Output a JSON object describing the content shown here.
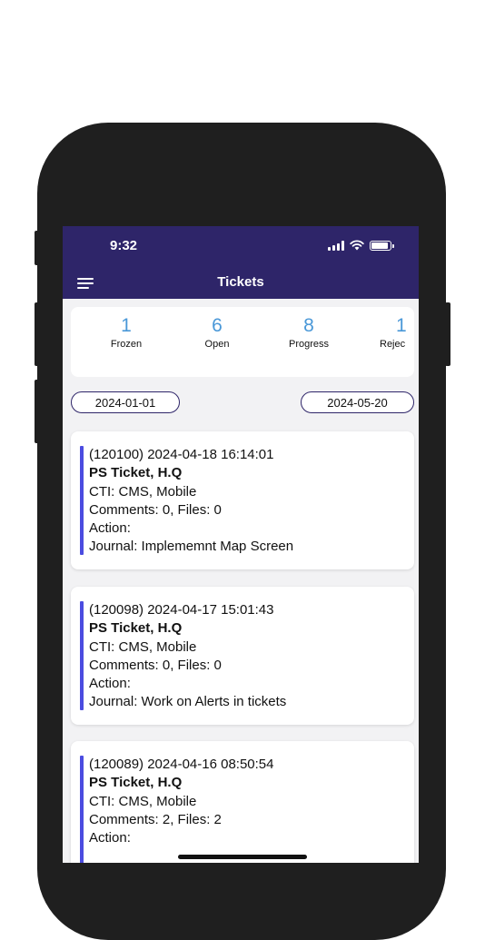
{
  "status_bar": {
    "time": "9:32"
  },
  "header": {
    "title": "Tickets"
  },
  "stats": [
    {
      "count": "1",
      "label": "Frozen"
    },
    {
      "count": "6",
      "label": "Open"
    },
    {
      "count": "8",
      "label": "Progress"
    },
    {
      "count": "1",
      "label": "Rejec"
    }
  ],
  "dates": {
    "start": "2024-01-01",
    "end": "2024-05-20"
  },
  "tickets": [
    {
      "header": "(120100) 2024-04-18 16:14:01",
      "title": "PS Ticket, H.Q",
      "cti": "CTI: CMS, Mobile",
      "counts": "Comments: 0, Files: 0",
      "action": "Action:",
      "journal": "Journal: Implememnt Map Screen"
    },
    {
      "header": "(120098) 2024-04-17 15:01:43",
      "title": "PS Ticket, H.Q",
      "cti": "CTI: CMS, Mobile",
      "counts": "Comments: 0, Files: 0",
      "action": "Action:",
      "journal": "Journal: Work on Alerts in tickets"
    },
    {
      "header": "(120089) 2024-04-16 08:50:54",
      "title": "PS Ticket, H.Q",
      "cti": "CTI: CMS, Mobile",
      "counts": "Comments: 2, Files: 2",
      "action": "Action:",
      "journal": ""
    }
  ],
  "colors": {
    "header_bg": "#2e2569",
    "accent": "#4b4ce0",
    "stat_number": "#4a98d8"
  }
}
